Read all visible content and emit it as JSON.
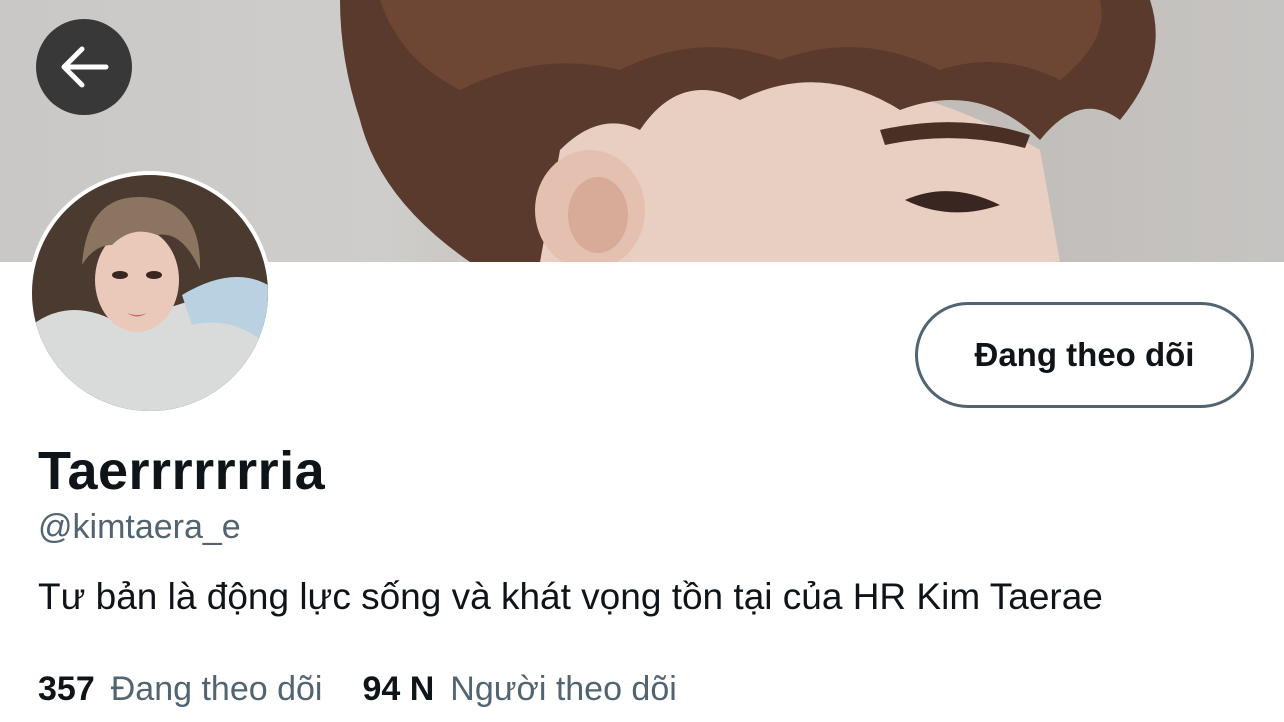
{
  "profile": {
    "display_name": "Taerrrrrrria",
    "handle": "@kimtaera_e",
    "bio": "Tư bản là động lực sống và khát vọng tồn tại của HR Kim Taerae",
    "follow_button_label": "Đang theo dõi"
  },
  "stats": {
    "following_count": "357",
    "following_label": "Đang theo dõi",
    "followers_count": "94 N",
    "followers_label": "Người theo dõi"
  },
  "icons": {
    "back": "arrow-left-icon"
  },
  "colors": {
    "text_primary": "#0f1419",
    "text_secondary": "#536471",
    "back_button_bg": "#1e1e1e",
    "button_border": "#536471"
  }
}
